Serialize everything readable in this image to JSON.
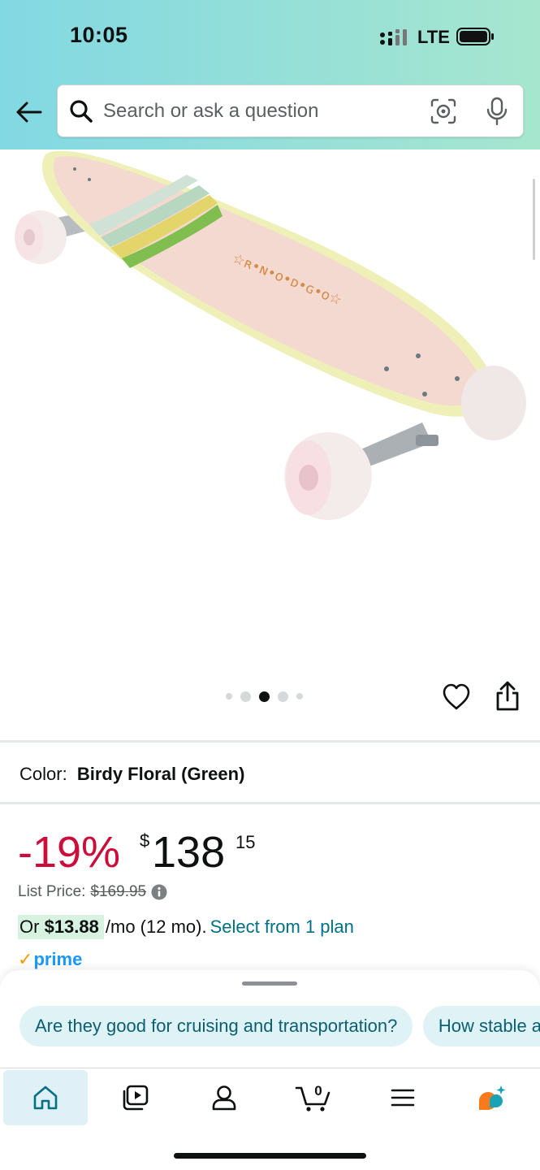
{
  "status_bar": {
    "time": "10:05",
    "network": "LTE"
  },
  "search": {
    "placeholder": "Search or ask a question"
  },
  "product": {
    "image_dots": {
      "count": 5,
      "active_index": 2
    },
    "color_label": "Color:",
    "color_value": "Birdy Floral (Green)",
    "discount": "-19%",
    "price_symbol": "$",
    "price_whole": "138",
    "price_fraction": "15",
    "list_price_label": "List Price:",
    "list_price_value": "$169.95",
    "monthly_prefix": "Or",
    "monthly_amount": "$13.88",
    "monthly_rest": "/mo (12 mo).",
    "monthly_link": "Select from 1 plan",
    "prime_label": "prime"
  },
  "ask_sheet": {
    "chips": [
      "Are they good for cruising and transportation?",
      "How stable are they for beginners?"
    ]
  },
  "tab_bar": {
    "tabs": [
      "home",
      "inspire",
      "account",
      "cart",
      "menu",
      "rufus"
    ],
    "active": "home",
    "cart_count": "0"
  },
  "colors": {
    "header_gradient_start": "#82d8e3",
    "header_gradient_end": "#a6e6ce",
    "discount_red": "#cc0c39",
    "link_teal": "#007185",
    "prime_blue": "#1a98ff",
    "prime_check_orange": "#ff9900",
    "chip_bg": "#dff3f7",
    "active_tab_bg": "#dff0f6"
  },
  "icons": {
    "back": "arrow-left-icon",
    "search": "search-icon",
    "lens": "camera-lens-icon",
    "mic": "microphone-icon",
    "wishlist": "heart-icon",
    "share": "share-icon",
    "info": "info-icon"
  }
}
